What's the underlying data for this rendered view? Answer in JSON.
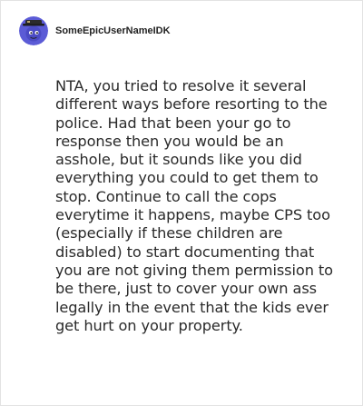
{
  "comment": {
    "username": "SomeEpicUserNameIDK",
    "avatar_icon": "avatar-icon",
    "text": "NTA, you tried to resolve it several different ways before resorting to the police. Had that been your go to response then you would be an asshole, but it sounds like you did everything you could to get them to stop. Continue to call the cops everytime it happens, maybe CPS too (especially if these children are disabled) to start documenting that you are not giving them permission to be there, just to cover your own ass legally in the event that the kids ever get hurt on your property."
  },
  "colors": {
    "avatar_bg": "#5b5bd6",
    "text": "#2a2a2a",
    "border": "#e3e3e3"
  }
}
